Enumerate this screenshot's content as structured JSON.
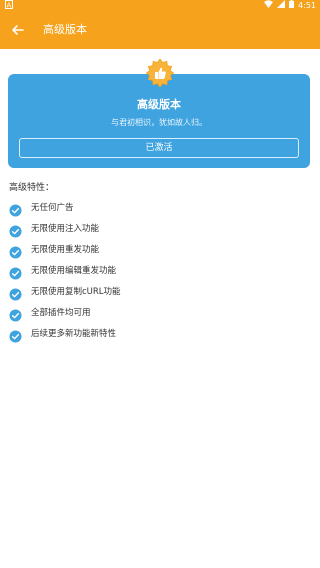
{
  "status_bar": {
    "left_icon": "android-icon",
    "time": "4:51",
    "wifi_icon": "wifi-icon",
    "signal_icon": "signal-icon",
    "battery_icon": "battery-icon"
  },
  "app_bar": {
    "title": "高级版本",
    "back_icon": "arrow-left-icon",
    "background": "#f6a21d"
  },
  "premium_card": {
    "badge_icon": "thumbs-up-badge-icon",
    "title": "高级版本",
    "subtitle": "与君初相识，犹如故人归。",
    "button_label": "已激活",
    "background": "#3ea3df"
  },
  "features": {
    "title": "高级特性：",
    "items": [
      "无任何广告",
      "无限使用注入功能",
      "无限使用重发功能",
      "无限使用编辑重发功能",
      "无限使用复制cURL功能",
      "全部插件均可用",
      "后续更多新功能新特性"
    ],
    "check_icon": "check-circle-icon",
    "check_color": "#3ea3df"
  }
}
